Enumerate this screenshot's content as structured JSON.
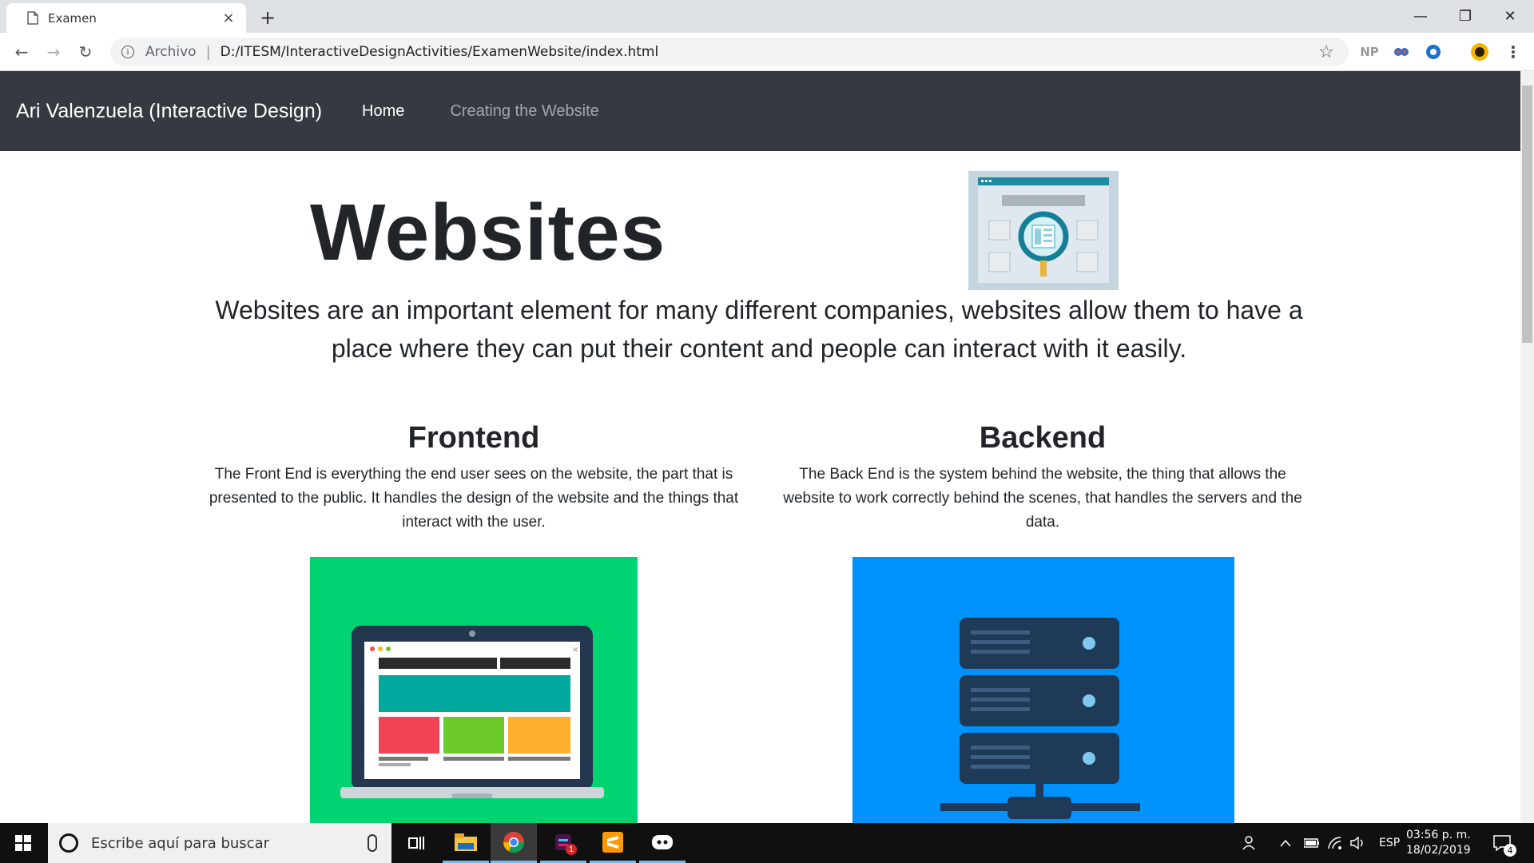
{
  "browser": {
    "tab_title": "Examen",
    "tab_close": "×",
    "new_tab": "+",
    "omnibox_label": "Archivo",
    "omnibox_separator": "|",
    "url": "D:/ITESM/InteractiveDesignActivities/ExamenWebsite/index.html",
    "extensions": [
      "NP"
    ],
    "window_controls": {
      "minimize": "—",
      "restore": "❐",
      "close": "✕"
    }
  },
  "site": {
    "brand": "Ari Valenzuela (Interactive Design)",
    "nav": {
      "home": "Home",
      "creating": "Creating the Website"
    },
    "hero": {
      "title": "Websites",
      "lead": "Websites are an important element for many different companies, websites allow them to have a place where they can put their content and people can interact with it easily."
    },
    "frontend": {
      "title": "Frontend",
      "text": "The Front End is everything the end user sees on the website, the part that is presented to the public. It handles the design of the website and the things that interact with the user."
    },
    "backend": {
      "title": "Backend",
      "text": "The Back End is the system behind the website, the thing that allows the website to work correctly behind the scenes, that handles the servers and the data."
    },
    "colors": {
      "navbar": "#343a40",
      "frontend_bg": "#00d372",
      "backend_bg": "#0092fc"
    }
  },
  "taskbar": {
    "search_placeholder": "Escribe aquí para buscar",
    "language": "ESP",
    "time": "03:56 p. m.",
    "date": "18/02/2019",
    "notification_count": "4",
    "slack_badge": "1"
  }
}
